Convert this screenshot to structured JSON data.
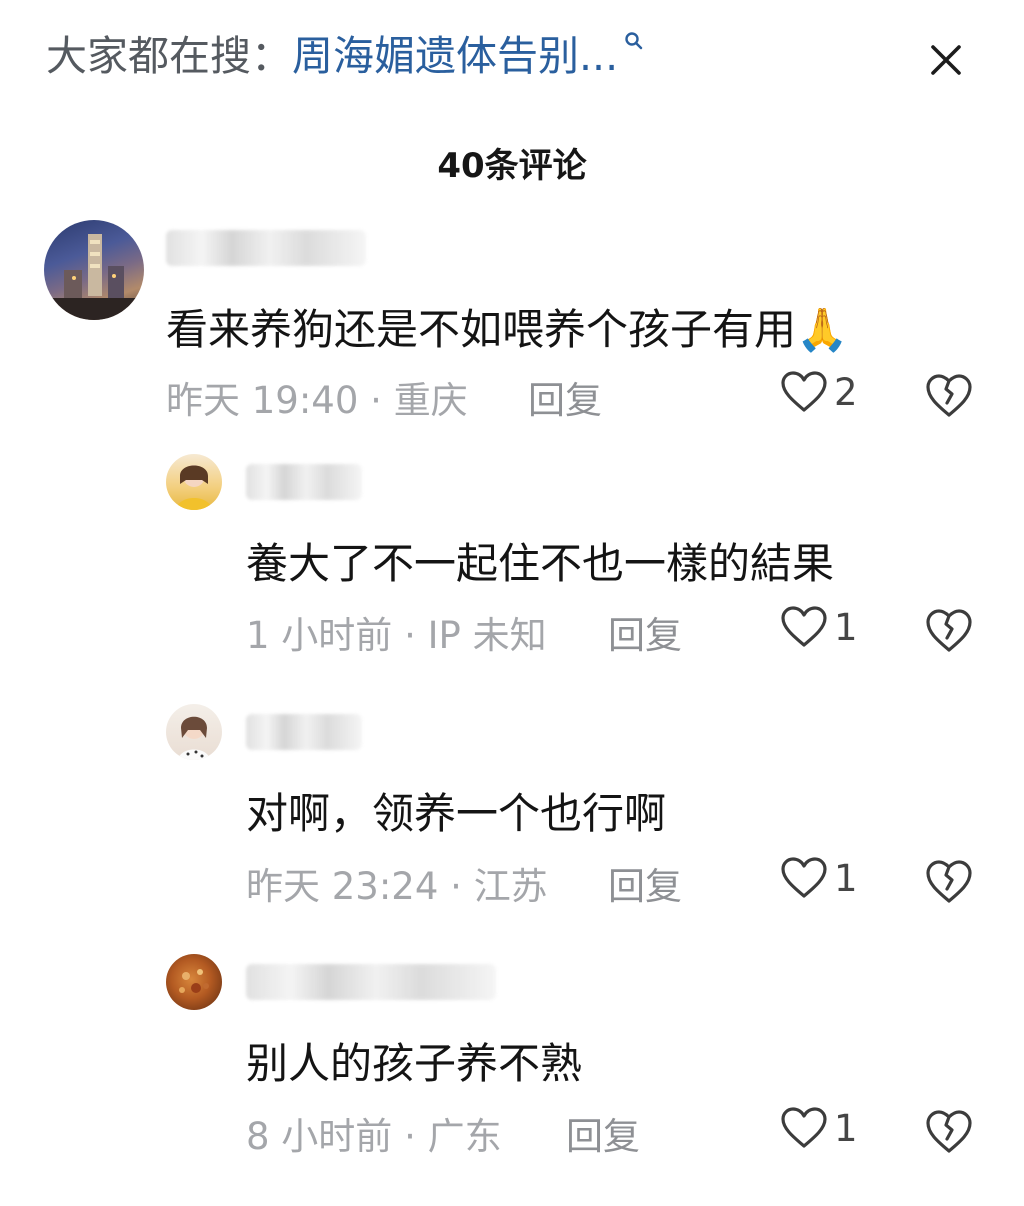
{
  "header": {
    "search_prefix": "大家都在搜：",
    "search_term": "周海媚遗体告别...",
    "comment_count": "40条评论"
  },
  "comments": [
    {
      "text": "看来养狗还是不如喂养个孩子有用🙏",
      "time": "昨天 19:40",
      "location": "重庆",
      "reply": "回复",
      "likes": "2"
    },
    {
      "text": "養大了不一起住不也一樣的結果",
      "time": "1 小时前",
      "location": "IP 未知",
      "reply": "回复",
      "likes": "1"
    },
    {
      "text": "对啊，领养一个也行啊",
      "time": "昨天 23:24",
      "location": "江苏",
      "reply": "回复",
      "likes": "1"
    },
    {
      "text": "别人的孩子养不熟",
      "time": "8 小时前",
      "location": "广东",
      "reply": "回复",
      "likes": "1"
    }
  ],
  "icons": {
    "search": "search-icon",
    "close": "close-icon",
    "like": "heart-outline-icon",
    "dislike": "broken-heart-icon"
  },
  "colors": {
    "search_term": "#2a5f9e",
    "meta_text": "#a4a6aa",
    "body_text": "#141414"
  }
}
